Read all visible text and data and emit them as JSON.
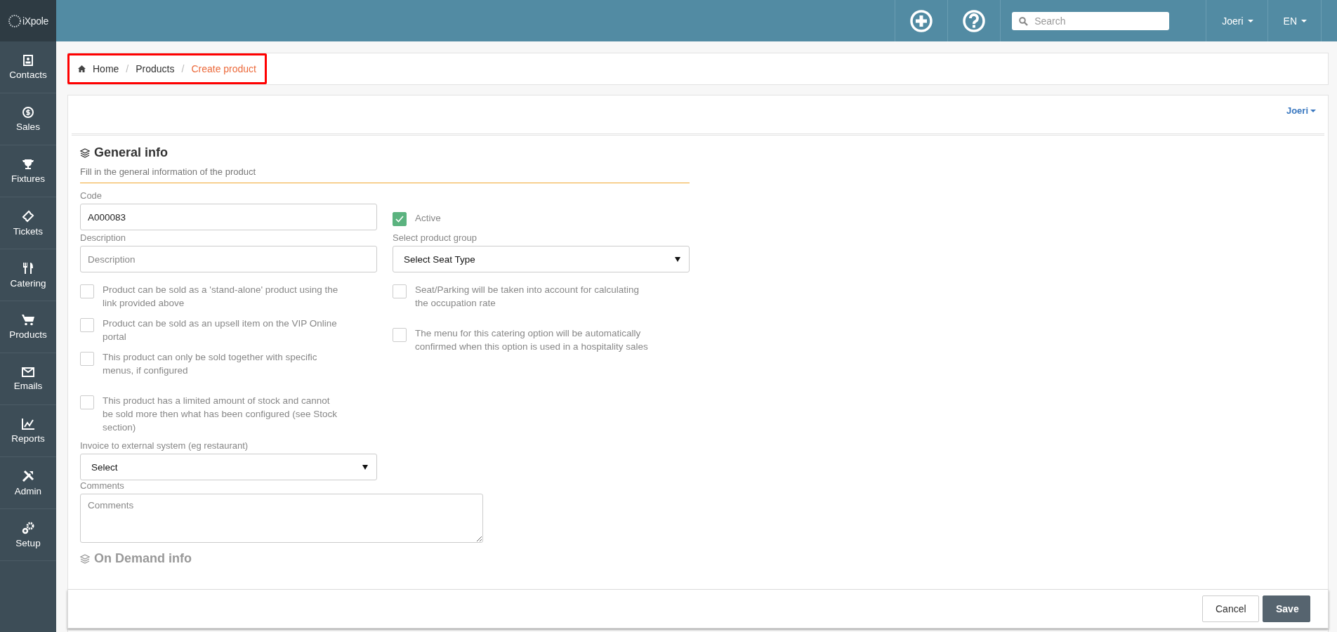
{
  "logo": "iXpole",
  "sidebar": {
    "items": [
      {
        "label": "Contacts",
        "selected": false
      },
      {
        "label": "Sales",
        "selected": false
      },
      {
        "label": "Fixtures",
        "selected": false
      },
      {
        "label": "Tickets",
        "selected": false
      },
      {
        "label": "Catering",
        "selected": false
      },
      {
        "label": "Products",
        "selected": false
      },
      {
        "label": "Emails",
        "selected": false
      },
      {
        "label": "Reports",
        "selected": false
      },
      {
        "label": "Admin",
        "selected": false
      },
      {
        "label": "Setup",
        "selected": false
      }
    ]
  },
  "topbar": {
    "search": {
      "placeholder": "Search"
    },
    "user_menu": "Joeri",
    "language_menu": "EN"
  },
  "breadcrumb": {
    "highlighted": true,
    "separators": [
      "/",
      "/"
    ],
    "items": [
      {
        "label": "Home",
        "selected": false
      },
      {
        "label": "Products",
        "selected": false
      },
      {
        "label": "Create product",
        "selected": true
      }
    ]
  },
  "card": {
    "user_menu": "Joeri",
    "section": {
      "title": "General info",
      "subtitle": "Fill in the general information of the product"
    },
    "code": {
      "label": "Code",
      "value": "A000083"
    },
    "active": {
      "label": "Active",
      "checked": true
    },
    "description": {
      "label": "Description",
      "placeholder": "Description"
    },
    "product_group": {
      "label": "Select product group",
      "value": "Select Seat Type"
    },
    "left_options": [
      {
        "label": "Product can be sold as a 'stand-alone' product using the link provided above",
        "checked": false
      },
      {
        "label": "Product can be sold as an upsell item on the VIP Online portal",
        "checked": false
      },
      {
        "label": "This product can only be sold together with specific menus, if configured",
        "checked": false
      },
      {
        "label": "This product has a limited amount of stock and cannot be sold more then what has been configured (see Stock section)",
        "checked": false
      }
    ],
    "right_options": [
      {
        "label": "Seat/Parking will be taken into account for calculating the occupation rate",
        "checked": false
      },
      {
        "label": "The menu for this catering option will be automatically confirmed when this option is used in a hospitality sales",
        "checked": false
      }
    ],
    "invoice": {
      "label": "Invoice to external system (eg restaurant)",
      "value": "Select"
    },
    "comments": {
      "label": "Comments",
      "placeholder": "Comments"
    },
    "next_section": {
      "title": "On Demand info"
    }
  },
  "footer": {
    "buttons": [
      {
        "label": "Cancel",
        "kind": "secondary"
      },
      {
        "label": "Save",
        "kind": "primary"
      }
    ]
  }
}
